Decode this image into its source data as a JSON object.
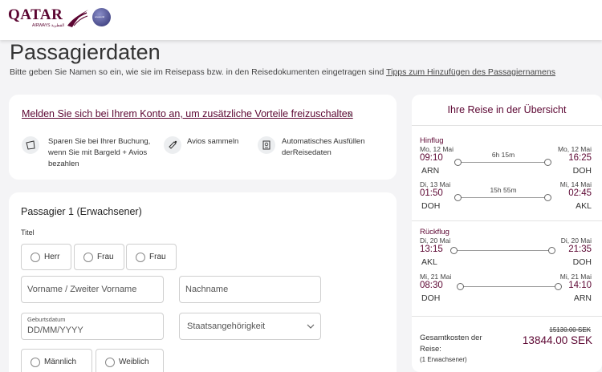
{
  "header": {
    "logo_text": "QATAR",
    "logo_subtext": "AIRWAYS القطرية",
    "alliance_text": "oneworld"
  },
  "page": {
    "title": "Passagierdaten",
    "subtitle": "Bitte geben Sie Namen so ein, wie sie im Reisepass bzw. in den Reisedokumenten eingetragen sind",
    "tips_link": "Tipps zum Hinzufügen des Passagiernamens"
  },
  "login": {
    "link": "Melden Sie sich bei Ihrem Konto an, um zusätzliche Vorteile freizuschalten",
    "benefits": [
      {
        "icon": "wallet-icon",
        "text": "Sparen Sie bei Ihrer Buchung, wenn Sie mit Bargeld + Avios bezahlen"
      },
      {
        "icon": "avios-icon",
        "text": "Avios sammeln"
      },
      {
        "icon": "passport-icon",
        "text": "Automatisches Ausfüllen derReisedaten"
      }
    ]
  },
  "passenger": {
    "title": "Passagier  1 (Erwachsener)",
    "title_label": "Titel",
    "titles": [
      "Herr",
      "Frau",
      "Frau"
    ],
    "first_name_placeholder": "Vorname / Zweiter Vorname",
    "last_name_placeholder": "Nachname",
    "dob_label": "Geburtsdatum",
    "dob_placeholder": "DD/MM/YYYY",
    "nationality_placeholder": "Staatsangehörigkeit",
    "genders": [
      "Männlich",
      "Weiblich"
    ]
  },
  "summary": {
    "title": "Ihre Reise in der Übersicht",
    "outbound_label": "Hinflug",
    "return_label": "Rückflug",
    "outbound": [
      {
        "dep_date": "Mo, 12 Mai",
        "dep_time": "09:10",
        "dep_code": "ARN",
        "duration": "6h 15m",
        "arr_date": "Mo, 12 Mai",
        "arr_time": "16:25",
        "arr_code": "DOH"
      },
      {
        "dep_date": "Di, 13 Mai",
        "dep_time": "01:50",
        "dep_code": "DOH",
        "duration": "15h 55m",
        "arr_date": "Mi, 14 Mai",
        "arr_time": "02:45",
        "arr_code": "AKL"
      }
    ],
    "return": [
      {
        "dep_date": "Di, 20 Mai",
        "dep_time": "13:15",
        "dep_code": "AKL",
        "duration": "",
        "arr_date": "Di, 20 Mai",
        "arr_time": "21:35",
        "arr_code": "DOH"
      },
      {
        "dep_date": "Mi, 21 Mai",
        "dep_time": "08:30",
        "dep_code": "DOH",
        "duration": "",
        "arr_date": "Mi, 21 Mai",
        "arr_time": "14:10",
        "arr_code": "ARN"
      }
    ],
    "total_label": "Gesamtkosten der Reise:",
    "total_sub": "(1 Erwachsener)",
    "old_price": "15130.00 SEK",
    "new_price": "13844.00 SEK"
  },
  "colors": {
    "brand": "#5c0632",
    "background": "#f4f4f6"
  }
}
